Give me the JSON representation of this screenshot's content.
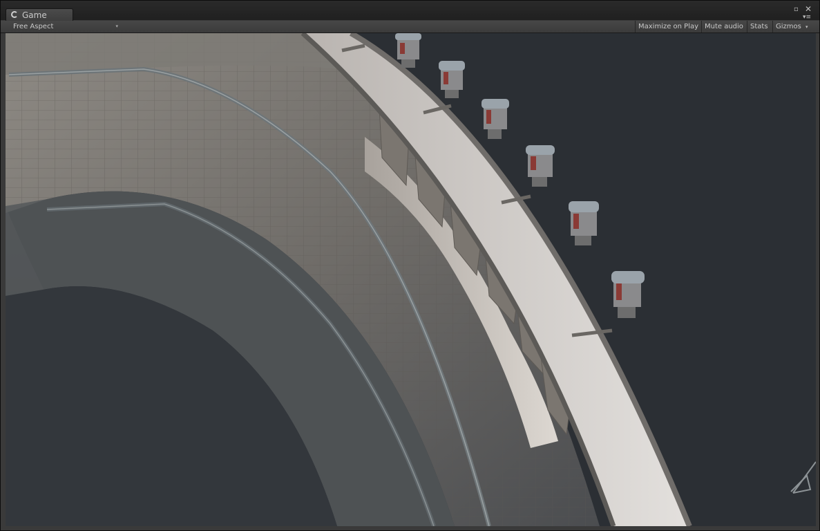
{
  "window": {
    "tab_title": "Game",
    "tab_icon": "unity-icon"
  },
  "toolbar": {
    "aspect_value": "Free Aspect",
    "maximize_label": "Maximize on Play",
    "mute_label": "Mute audio",
    "stats_label": "Stats",
    "gizmos_label": "Gizmos"
  },
  "scene": {
    "description_icon": "dam-scene",
    "sky_color": "#2b2f34",
    "concrete_color": "#8a8680"
  }
}
